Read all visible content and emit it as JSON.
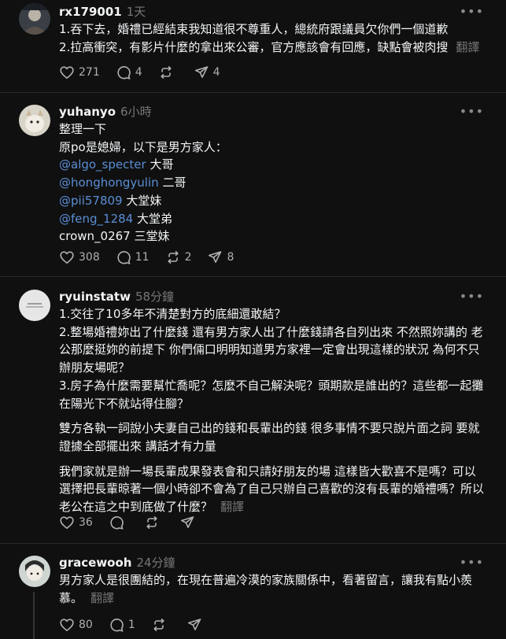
{
  "posts": [
    {
      "username": "rx179001",
      "time": "1天",
      "lines": [
        "1.吞下去，婚禮已經結束我知道很不尊重人，總統府跟議員欠你們一個道歉",
        "2.拉高衝突，有影片什麼的拿出來公審，官方應該會有回應，缺點會被肉搜"
      ],
      "translate": "翻譯",
      "likes": "271",
      "replies": "4",
      "reposts": "",
      "shares": "4"
    },
    {
      "username": "yuhanyo",
      "time": "6小時",
      "intro": [
        "整理一下",
        "原po是媳婦，以下是男方家人："
      ],
      "mentions": [
        {
          "handle": "@algo_specter",
          "relation": "大哥"
        },
        {
          "handle": "@honghongyulin",
          "relation": "二哥"
        },
        {
          "handle": "@pii57809",
          "relation": "大堂妹"
        },
        {
          "handle": "@feng_1284",
          "relation": "大堂弟"
        }
      ],
      "last_line": "crown_0267 三堂妹",
      "likes": "308",
      "replies": "11",
      "reposts": "2",
      "shares": "8"
    },
    {
      "username": "ryuinstatw",
      "time": "58分鐘",
      "para1": [
        "1.交往了10多年不清楚對方的底細還敢結？",
        "2.整場婚禮妳出了什麼錢 還有男方家人出了什麼錢請各自列出來 不然照妳講的 老",
        "公那麼挺妳的前提下 你們倆口明明知道男方家裡一定會出現這樣的狀況 為何不只",
        "辦朋友場呢？",
        "3.房子為什麼需要幫忙喬呢？怎麼不自己解決呢？頭期款是誰出的？這些都一起攤",
        "在陽光下不就站得住腳？"
      ],
      "para2": [
        "雙方各執一詞說小夫妻自己出的錢和長輩出的錢 很多事情不要只說片面之詞 要就",
        "證據全部擺出來 講話才有力量"
      ],
      "para3": [
        "我們家就是辦一場長輩成果發表會和只請好朋友的場 這樣皆大歡喜不是嗎？可以",
        "選擇把長輩晾著一個小時卻不會為了自己只辦自己喜歡的沒有長輩的婚禮嗎？所以",
        "老公在這之中到底做了什麼？"
      ],
      "translate": "翻譯",
      "likes": "36",
      "replies": "",
      "reposts": "",
      "shares": ""
    },
    {
      "username": "gracewooh",
      "time": "24分鐘",
      "lines": [
        "男方家人是很團結的，在現在普遍冷漠的家族關係中，看著留言，讓我有點小羨",
        "慕。"
      ],
      "translate": "翻譯",
      "likes": "80",
      "replies": "1",
      "reposts": "",
      "shares": ""
    }
  ]
}
